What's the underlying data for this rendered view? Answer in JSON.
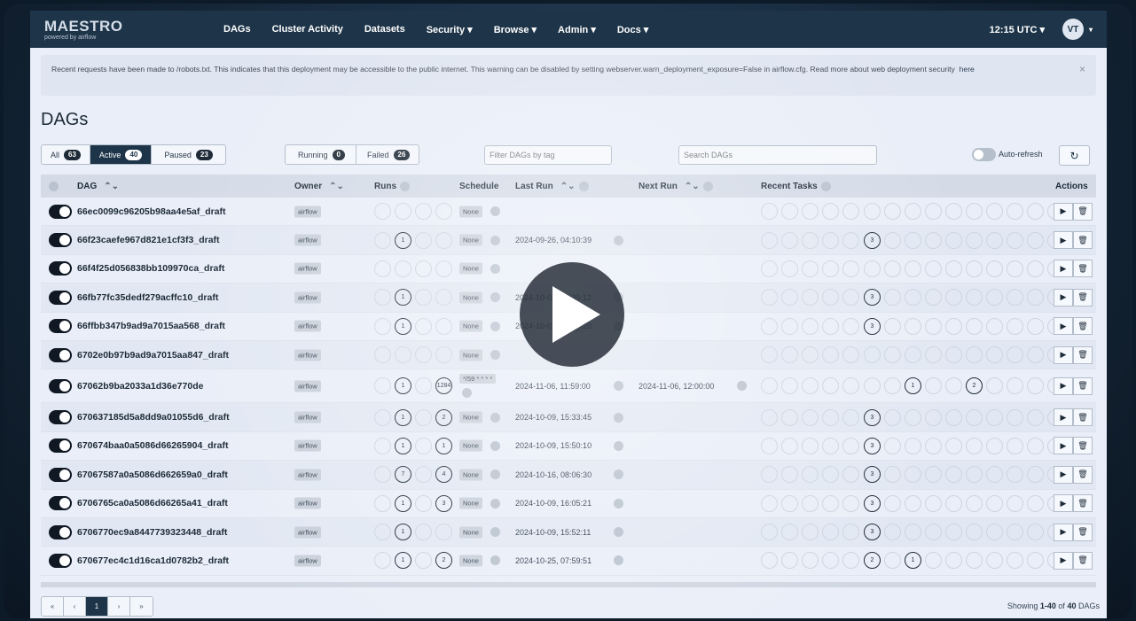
{
  "nav": {
    "logo": "MAESTRO",
    "logo_sub": "powered by airflow",
    "menu": [
      "DAGs",
      "Cluster Activity",
      "Datasets",
      "Security ▾",
      "Browse ▾",
      "Admin ▾",
      "Docs ▾"
    ],
    "time": "12:15 UTC ▾",
    "avatar": "VT"
  },
  "banner": {
    "text": "Recent requests have been made to /robots.txt. This indicates that this deployment may be accessible to the public internet. This warning can be disabled by setting webserver.warn_deployment_exposure=False in airflow.cfg. Read more about web deployment security",
    "link": "here",
    "close": "×"
  },
  "page_title": "DAGs",
  "filters": {
    "all_label": "All",
    "all_count": "63",
    "active_label": "Active",
    "active_count": "40",
    "paused_label": "Paused",
    "paused_count": "23",
    "running_label": "Running",
    "running_count": "0",
    "failed_label": "Failed",
    "failed_count": "26",
    "tag_placeholder": "Filter DAGs by tag",
    "search_placeholder": "Search DAGs",
    "autorefresh": "Auto-refresh",
    "refresh_icon": "↻"
  },
  "columns": {
    "dag": "DAG",
    "owner": "Owner",
    "runs": "Runs",
    "schedule": "Schedule",
    "last_run": "Last Run",
    "next_run": "Next Run",
    "recent_tasks": "Recent Tasks",
    "actions": "Actions"
  },
  "rows": [
    {
      "id": "66ec0099c96205b98aa4e5af_draft",
      "owner": "airflow",
      "schedule": "None",
      "last_run": "",
      "next_run": "",
      "runs": [
        "",
        "",
        "",
        ""
      ],
      "tasks": []
    },
    {
      "id": "66f23caefe967d821e1cf3f3_draft",
      "owner": "airflow",
      "schedule": "None",
      "last_run": "2024-09-26, 04:10:39",
      "next_run": "",
      "runs": [
        "",
        "1",
        "",
        ""
      ],
      "tasks": [
        {
          "pos": 5,
          "n": "3"
        }
      ]
    },
    {
      "id": "66f4f25d056838bb109970ca_draft",
      "owner": "airflow",
      "schedule": "None",
      "last_run": "",
      "next_run": "",
      "runs": [
        "",
        "",
        "",
        ""
      ],
      "tasks": []
    },
    {
      "id": "66fb77fc35dedf279acffc10_draft",
      "owner": "airflow",
      "schedule": "None",
      "last_run": "2024-10-0_, 05:35:12",
      "next_run": "",
      "runs": [
        "",
        "1",
        "",
        ""
      ],
      "tasks": [
        {
          "pos": 5,
          "n": "3"
        }
      ]
    },
    {
      "id": "66ffbb347b9ad9a7015aa568_draft",
      "owner": "airflow",
      "schedule": "None",
      "last_run": "2024-10-0_, __:__:20",
      "next_run": "",
      "runs": [
        "",
        "1",
        "",
        ""
      ],
      "tasks": [
        {
          "pos": 5,
          "n": "3"
        }
      ]
    },
    {
      "id": "6702e0b97b9ad9a7015aa847_draft",
      "owner": "airflow",
      "schedule": "None",
      "last_run": "",
      "next_run": "",
      "runs": [
        "",
        "",
        "",
        ""
      ],
      "tasks": []
    },
    {
      "id": "67062b9ba2033a1d36e770de",
      "owner": "airflow",
      "schedule": "*/59 * * * *",
      "last_run": "2024-11-06, 11:59:00",
      "next_run": "2024-11-06, 12:00:00",
      "runs": [
        "",
        "1",
        "",
        "1284"
      ],
      "tasks": [
        {
          "pos": 7,
          "n": "1"
        },
        {
          "pos": 10,
          "n": "2"
        }
      ]
    },
    {
      "id": "670637185d5a8dd9a01055d6_draft",
      "owner": "airflow",
      "schedule": "None",
      "last_run": "2024-10-09, 15:33:45",
      "next_run": "",
      "runs": [
        "",
        "1",
        "",
        "2"
      ],
      "tasks": [
        {
          "pos": 5,
          "n": "3"
        }
      ]
    },
    {
      "id": "670674baa0a5086d66265904_draft",
      "owner": "airflow",
      "schedule": "None",
      "last_run": "2024-10-09, 15:50:10",
      "next_run": "",
      "runs": [
        "",
        "1",
        "",
        "1"
      ],
      "tasks": [
        {
          "pos": 5,
          "n": "3"
        }
      ]
    },
    {
      "id": "67067587a0a5086d662659a0_draft",
      "owner": "airflow",
      "schedule": "None",
      "last_run": "2024-10-16, 08:06:30",
      "next_run": "",
      "runs": [
        "",
        "7",
        "",
        "4"
      ],
      "tasks": [
        {
          "pos": 5,
          "n": "3"
        }
      ]
    },
    {
      "id": "6706765ca0a5086d66265a41_draft",
      "owner": "airflow",
      "schedule": "None",
      "last_run": "2024-10-09, 16:05:21",
      "next_run": "",
      "runs": [
        "",
        "1",
        "",
        "3"
      ],
      "tasks": [
        {
          "pos": 5,
          "n": "3"
        }
      ]
    },
    {
      "id": "6706770ec9a8447739323448_draft",
      "owner": "airflow",
      "schedule": "None",
      "last_run": "2024-10-09, 15:52:11",
      "next_run": "",
      "runs": [
        "",
        "1",
        "",
        ""
      ],
      "tasks": [
        {
          "pos": 5,
          "n": "3"
        }
      ]
    },
    {
      "id": "670677ec4c1d16ca1d0782b2_draft",
      "owner": "airflow",
      "schedule": "None",
      "last_run": "2024-10-25, 07:59:51",
      "next_run": "",
      "runs": [
        "",
        "1",
        "",
        "2"
      ],
      "tasks": [
        {
          "pos": 5,
          "n": "2"
        },
        {
          "pos": 7,
          "n": "1"
        }
      ]
    }
  ],
  "row_actions": {
    "play": "▶",
    "delete": "🗑"
  },
  "pager": [
    "«",
    "‹",
    "1",
    "›",
    "»"
  ],
  "showing": {
    "prefix": "Showing",
    "range": "1-40",
    "of": "of",
    "total": "40",
    "suffix": "DAGs"
  }
}
